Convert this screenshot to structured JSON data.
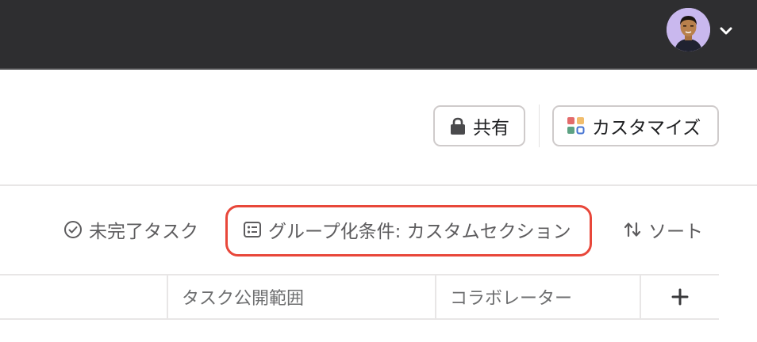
{
  "header": {
    "avatar_icon": "user-avatar",
    "menu_icon": "chevron-down-icon"
  },
  "actions": {
    "share_label": "共有",
    "customize_label": "カスタマイズ"
  },
  "toolbar": {
    "incomplete_label": "未完了タスク",
    "group_label": "グループ化条件: カスタムセクション",
    "sort_label": "ソート"
  },
  "table": {
    "columns": [
      "タスク公開範囲",
      "コラボレーター"
    ],
    "add_column_icon": "plus-icon"
  },
  "colors": {
    "topbar": "#2e2e30",
    "highlight": "#e8473a",
    "avatar_bg": "#c9b8ee"
  }
}
